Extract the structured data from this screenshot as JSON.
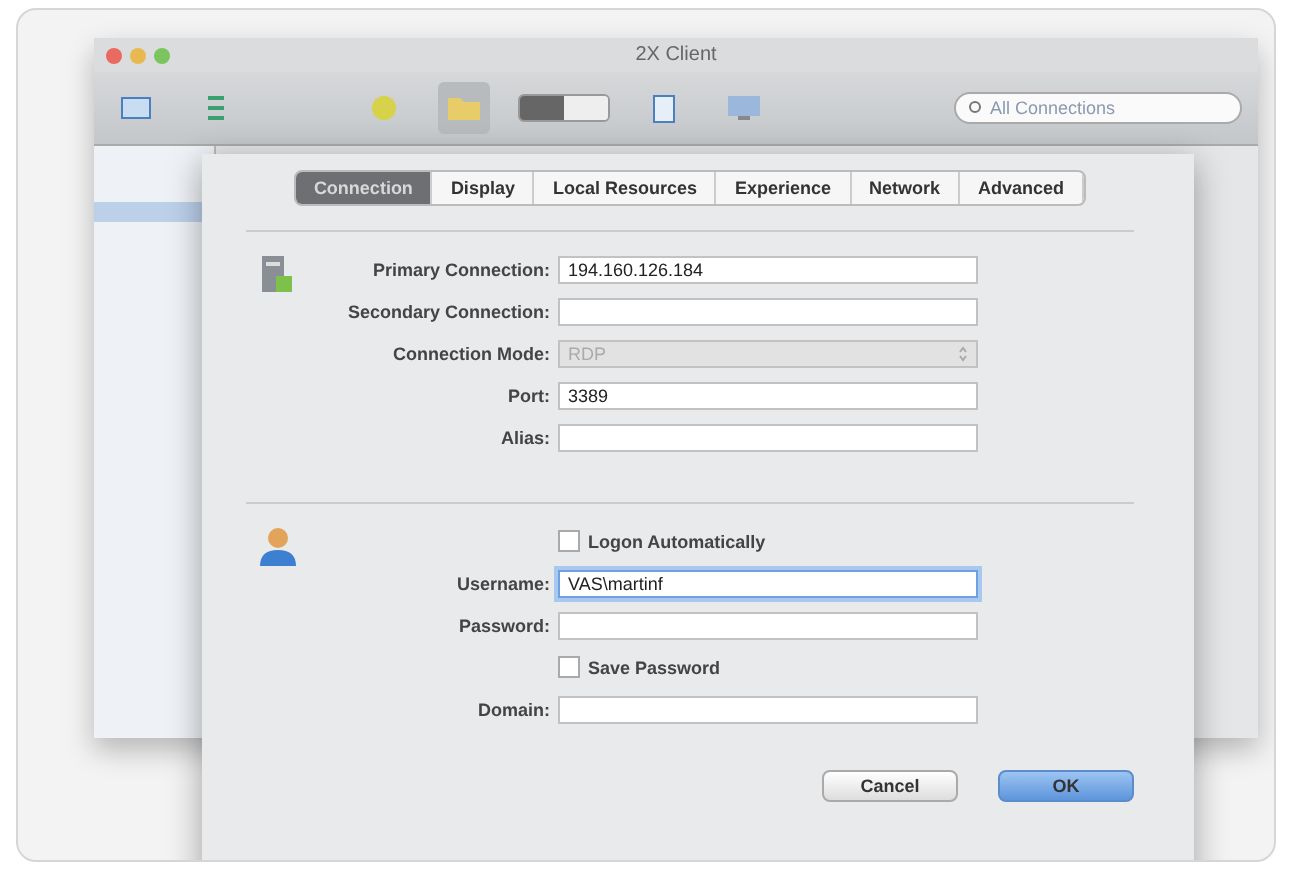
{
  "window": {
    "title": "2X Client"
  },
  "toolbar": {
    "search": {
      "placeholder": "All Connections"
    }
  },
  "tabs": [
    {
      "label": "Connection",
      "selected": true
    },
    {
      "label": "Display",
      "selected": false
    },
    {
      "label": "Local Resources",
      "selected": false
    },
    {
      "label": "Experience",
      "selected": false
    },
    {
      "label": "Network",
      "selected": false
    },
    {
      "label": "Advanced",
      "selected": false
    }
  ],
  "sections": [
    {
      "rows": [
        {
          "kind": "field",
          "label": "Primary Connection:",
          "value": "194.160.126.184",
          "focused": false
        },
        {
          "kind": "field",
          "label": "Secondary Connection:",
          "focused": false
        },
        {
          "kind": "select",
          "label": "Connection Mode:",
          "value": "RDP",
          "disabled": true
        },
        {
          "kind": "field",
          "label": "Port:",
          "value": "3389",
          "focused": false
        },
        {
          "kind": "field",
          "label": "Alias:",
          "focused": false
        }
      ]
    },
    {
      "rows": [
        {
          "kind": "checkbox",
          "label": "Logon Automatically",
          "checked": false
        },
        {
          "kind": "field",
          "label": "Username:",
          "value": "VAS\\martinf",
          "focused": true
        },
        {
          "kind": "field",
          "label": "Password:",
          "focused": false
        },
        {
          "kind": "checkbox",
          "label": "Save Password",
          "checked": false
        },
        {
          "kind": "field",
          "label": "Domain:",
          "focused": false
        }
      ]
    }
  ],
  "buttons": [
    {
      "label": "Cancel",
      "default": false
    },
    {
      "label": "OK",
      "default": true
    }
  ]
}
